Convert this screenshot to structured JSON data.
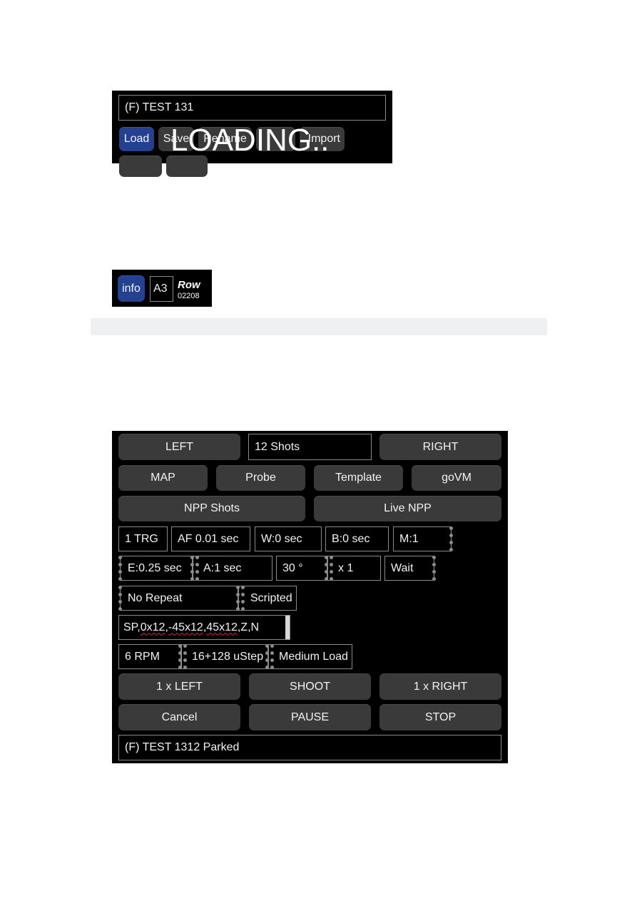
{
  "file_panel": {
    "filename": "(F) TEST 131",
    "buttons": [
      "Load",
      "Save",
      "Rename",
      "",
      "Import"
    ],
    "overlay_text": "LOADING..",
    "accent_color": "#24418f"
  },
  "info_panel": {
    "info_button": "info",
    "cell": "A3",
    "row_label": "Row",
    "row_value": "02208"
  },
  "control_panel": {
    "row1": {
      "left": "LEFT",
      "shots": "12 Shots",
      "right": "RIGHT"
    },
    "row2": [
      "MAP",
      "Probe",
      "Template",
      "goVM"
    ],
    "row3": [
      "NPP Shots",
      "Live NPP"
    ],
    "row4": {
      "trigger": "1 TRG",
      "af": "AF 0.01 sec",
      "wait": "W:0 sec",
      "bulb": "B:0 sec",
      "mode": "M:1"
    },
    "row5": {
      "exposure": "E:0.25 sec",
      "after": "A:1 sec",
      "angle": "30 °",
      "multiplier": "x 1",
      "wait": "Wait"
    },
    "row6": {
      "repeat": "No Repeat",
      "type": "Scripted"
    },
    "script": {
      "prefix": "SP,",
      "p1": "0x12",
      "sep1": ",",
      "p2": "-45x12",
      "sep2": ",",
      "p3": "45x12",
      "suffix": ",Z,N"
    },
    "row8": {
      "speed": "6 RPM",
      "microstep": "16+128 uStep",
      "load": "Medium Load"
    },
    "row9": [
      "1 x LEFT",
      "SHOOT",
      "1 x RIGHT"
    ],
    "row10": [
      "Cancel",
      "PAUSE",
      "STOP"
    ],
    "status": "(F) TEST 1312 Parked"
  }
}
